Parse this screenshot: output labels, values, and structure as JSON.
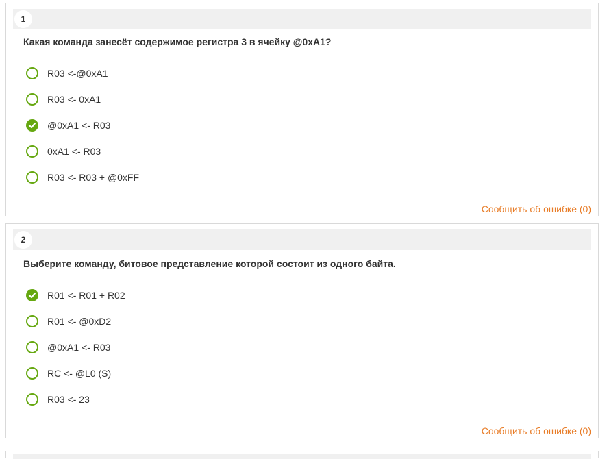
{
  "questions": [
    {
      "number": "1",
      "text": "Какая команда занесёт содержимое регистра 3 в ячейку @0xA1?",
      "options": [
        {
          "label": "R03 <-@0xA1",
          "checked": false
        },
        {
          "label": "R03 <- 0xA1",
          "checked": false
        },
        {
          "label": "@0xA1 <- R03",
          "checked": true
        },
        {
          "label": "0xA1 <- R03",
          "checked": false
        },
        {
          "label": "R03 <- R03 + @0xFF",
          "checked": false
        }
      ],
      "report_label": "Сообщить об ошибке (0)"
    },
    {
      "number": "2",
      "text": "Выберите команду, битовое представление которой состоит из одного байта.",
      "options": [
        {
          "label": "R01 <- R01 + R02",
          "checked": true
        },
        {
          "label": "R01 <- @0xD2",
          "checked": false
        },
        {
          "label": "@0xA1 <- R03",
          "checked": false
        },
        {
          "label": "RC <- @L0 (S)",
          "checked": false
        },
        {
          "label": "R03 <- 23",
          "checked": false
        }
      ],
      "report_label": "Сообщить об ошибке (0)"
    }
  ],
  "colors": {
    "accent_green": "#66a811",
    "report_orange": "#e87c27",
    "header_bg": "#f0f0f0",
    "border": "#d9d9d9"
  },
  "icons": {
    "checked": "check-circle-icon",
    "unchecked": "radio-empty-icon"
  }
}
